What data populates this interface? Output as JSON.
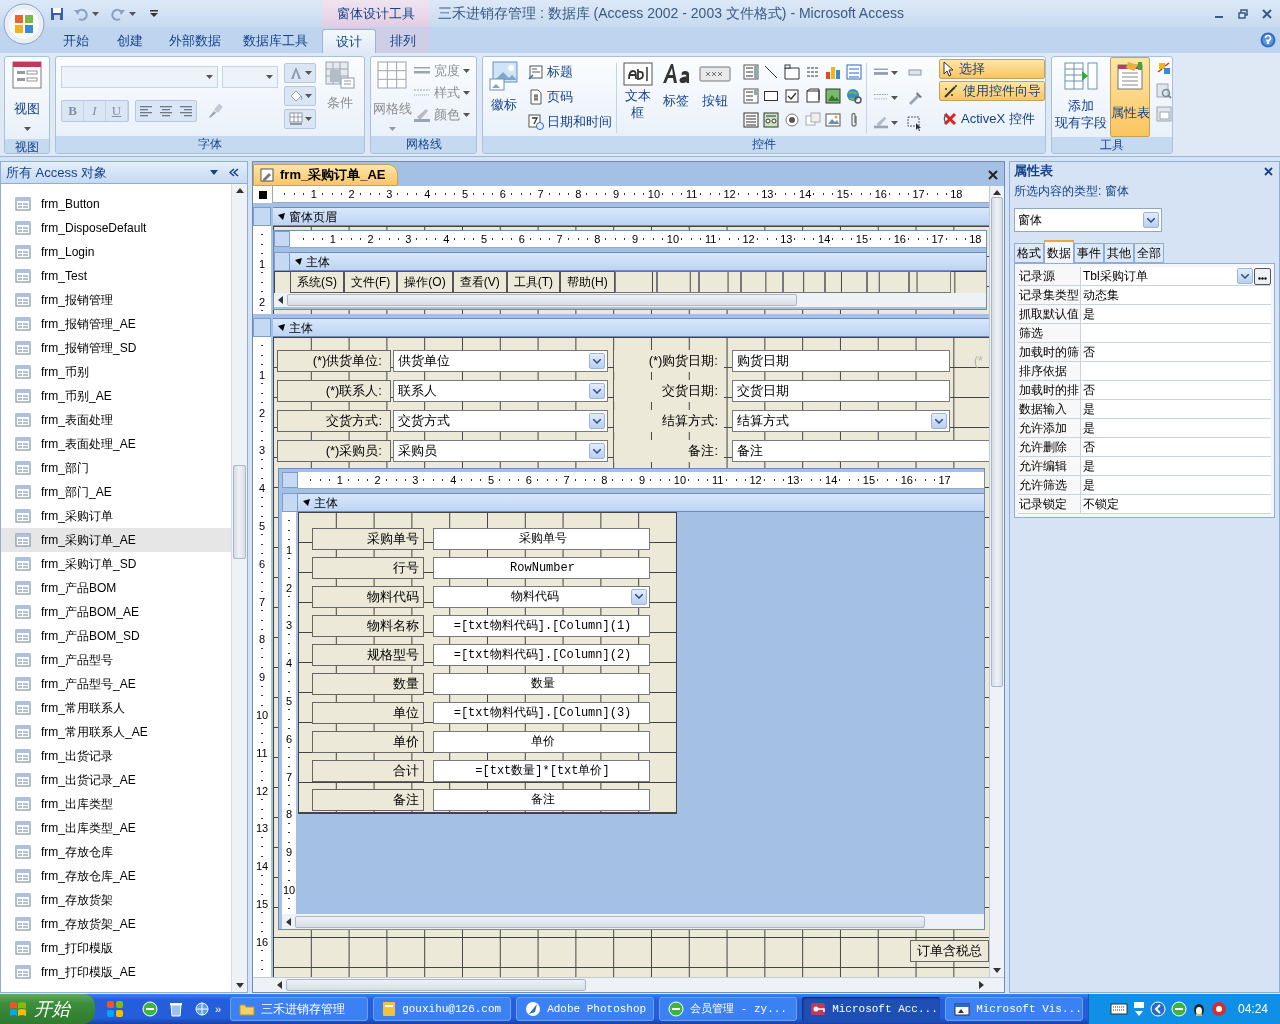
{
  "window": {
    "title": "三禾进销存管理 : 数据库 (Access 2002 - 2003 文件格式) - Microsoft Access",
    "context_tab": "窗体设计工具"
  },
  "ribbon_tabs": [
    {
      "label": "开始",
      "selected": false
    },
    {
      "label": "创建",
      "selected": false
    },
    {
      "label": "外部数据",
      "selected": false
    },
    {
      "label": "数据库工具",
      "selected": false
    },
    {
      "label": "设计",
      "selected": true
    },
    {
      "label": "排列",
      "selected": false
    }
  ],
  "ribbon": {
    "view_group": {
      "caption": "视图",
      "button": "视图"
    },
    "font_group": {
      "caption": "字体",
      "format_buttons": [
        "B",
        "I",
        "U"
      ],
      "condition": "条件",
      "disabled": true
    },
    "gridlines_group": {
      "caption": "网格线",
      "gridlines": "网格线",
      "options": [
        "宽度",
        "样式",
        "颜色"
      ],
      "disabled": true
    },
    "controls_group": {
      "caption": "控件",
      "logo": "徽标",
      "small_buttons": [
        "标题",
        "页码",
        "日期和时间"
      ],
      "text_box": [
        "文本",
        "框"
      ],
      "label": "标签",
      "button": "按钮",
      "select": {
        "label": "选择",
        "on": true
      },
      "wizard": {
        "label": "使用控件向导",
        "on": true
      },
      "activex": "ActiveX 控件"
    },
    "tools_group": {
      "caption": "工具",
      "add_fields": [
        "添加",
        "现有字段"
      ],
      "property_sheet": {
        "label": "属性表",
        "on": true
      }
    }
  },
  "navigation": {
    "header": "所有 Access 对象",
    "items": [
      {
        "label": "frm_Button",
        "selected": false
      },
      {
        "label": "frm_DisposeDefault",
        "selected": false
      },
      {
        "label": "frm_Login",
        "selected": false
      },
      {
        "label": "frm_Test",
        "selected": false
      },
      {
        "label": "frm_报销管理",
        "selected": false
      },
      {
        "label": "frm_报销管理_AE",
        "selected": false
      },
      {
        "label": "frm_报销管理_SD",
        "selected": false
      },
      {
        "label": "frm_币别",
        "selected": false
      },
      {
        "label": "frm_币别_AE",
        "selected": false
      },
      {
        "label": "frm_表面处理",
        "selected": false
      },
      {
        "label": "frm_表面处理_AE",
        "selected": false
      },
      {
        "label": "frm_部门",
        "selected": false
      },
      {
        "label": "frm_部门_AE",
        "selected": false
      },
      {
        "label": "frm_采购订单",
        "selected": false
      },
      {
        "label": "frm_采购订单_AE",
        "selected": true
      },
      {
        "label": "frm_采购订单_SD",
        "selected": false
      },
      {
        "label": "frm_产品BOM",
        "selected": false
      },
      {
        "label": "frm_产品BOM_AE",
        "selected": false
      },
      {
        "label": "frm_产品BOM_SD",
        "selected": false
      },
      {
        "label": "frm_产品型号",
        "selected": false
      },
      {
        "label": "frm_产品型号_AE",
        "selected": false
      },
      {
        "label": "frm_常用联系人",
        "selected": false
      },
      {
        "label": "frm_常用联系人_AE",
        "selected": false
      },
      {
        "label": "frm_出货记录",
        "selected": false
      },
      {
        "label": "frm_出货记录_AE",
        "selected": false
      },
      {
        "label": "frm_出库类型",
        "selected": false
      },
      {
        "label": "frm_出库类型_AE",
        "selected": false
      },
      {
        "label": "frm_存放仓库",
        "selected": false
      },
      {
        "label": "frm_存放仓库_AE",
        "selected": false
      },
      {
        "label": "frm_存放货架",
        "selected": false
      },
      {
        "label": "frm_存放货架_AE",
        "selected": false
      },
      {
        "label": "frm_打印模版",
        "selected": false
      },
      {
        "label": "frm_打印模版_AE",
        "selected": false
      }
    ]
  },
  "designer": {
    "tab": "frm_采购订单_AE",
    "ruler": [
      "1",
      "2",
      "3",
      "4",
      "5",
      "6",
      "7",
      "8",
      "9",
      "10",
      "11",
      "12",
      "13",
      "14",
      "15",
      "16",
      "17",
      "18"
    ],
    "vertical_ruler_header": [
      "1",
      "2"
    ],
    "vertical_ruler_detail": [
      "1",
      "2",
      "3",
      "4",
      "5",
      "6",
      "7",
      "8",
      "9",
      "10",
      "11",
      "12",
      "13",
      "14",
      "15",
      "16"
    ],
    "form_header": {
      "title": "窗体页眉",
      "menu_subform": {
        "ruler": [
          "1",
          "2",
          "3",
          "4",
          "5",
          "6",
          "7",
          "8",
          "9",
          "10",
          "11",
          "12",
          "13",
          "14",
          "15",
          "16",
          "17",
          "18"
        ],
        "section": "主体",
        "menu_buttons": [
          "系统(S)",
          "文件(F)",
          "操作(O)",
          "查看(V)",
          "工具(T)",
          "帮助(H)"
        ]
      }
    },
    "detail": {
      "title": "主体",
      "left_fields": [
        {
          "label": "(*)供货单位:",
          "value": "供货单位",
          "kind": "combo"
        },
        {
          "label": "(*)联系人:",
          "value": "联系人",
          "kind": "combo"
        },
        {
          "label": "交货方式:",
          "value": "交货方式",
          "kind": "combo"
        },
        {
          "label": "(*)采购员:",
          "value": "采购员",
          "kind": "combo"
        }
      ],
      "right_fields": [
        {
          "label": "(*)购货日期:",
          "value": "购货日期",
          "kind": "text"
        },
        {
          "label": "交货日期:",
          "value": "交货日期",
          "kind": "text"
        },
        {
          "label": "结算方式:",
          "value": "结算方式",
          "kind": "combo"
        },
        {
          "label": "备注:",
          "value": "备注",
          "kind": "wide"
        }
      ],
      "edge_label": "(*",
      "lines_subform": {
        "ruler": [
          "1",
          "2",
          "3",
          "4",
          "5",
          "6",
          "7",
          "8",
          "9",
          "10",
          "11",
          "12",
          "13",
          "14",
          "15",
          "16",
          "17"
        ],
        "vertical_ruler": [
          "1",
          "2",
          "3",
          "4",
          "5",
          "6",
          "7",
          "8",
          "9",
          "10"
        ],
        "section": "主体",
        "fields": [
          {
            "label": "采购单号",
            "value": "采购单号",
            "kind": "text"
          },
          {
            "label": "行号",
            "value": "RowNumber",
            "kind": "text"
          },
          {
            "label": "物料代码",
            "value": "物料代码",
            "kind": "combo"
          },
          {
            "label": "物料名称",
            "value": "=[txt物料代码].[Column](1)",
            "kind": "text"
          },
          {
            "label": "规格型号",
            "value": "=[txt物料代码].[Column](2)",
            "kind": "text"
          },
          {
            "label": "数量",
            "value": "数量",
            "kind": "text"
          },
          {
            "label": "单位",
            "value": "=[txt物料代码].[Column](3)",
            "kind": "text"
          },
          {
            "label": "单价",
            "value": "单价",
            "kind": "text"
          },
          {
            "label": "合计",
            "value": "=[txt数量]*[txt单价]",
            "kind": "text"
          },
          {
            "label": "备注",
            "value": "备注",
            "kind": "text"
          }
        ]
      },
      "total_label": "订单含税总"
    }
  },
  "property_sheet": {
    "title": "属性表",
    "selection_type": "所选内容的类型: 窗体",
    "object": "窗体",
    "tabs": [
      {
        "label": "格式",
        "selected": false
      },
      {
        "label": "数据",
        "selected": true
      },
      {
        "label": "事件",
        "selected": false
      },
      {
        "label": "其他",
        "selected": false
      },
      {
        "label": "全部",
        "selected": false
      }
    ],
    "rows": [
      {
        "name": "记录源",
        "value": "Tbl采购订单",
        "kind": "builder"
      },
      {
        "name": "记录集类型",
        "value": "动态集",
        "kind": "plain"
      },
      {
        "name": "抓取默认值",
        "value": "是",
        "kind": "plain"
      },
      {
        "name": "筛选",
        "kind": "plain"
      },
      {
        "name": "加载时的筛",
        "value": "否",
        "kind": "plain"
      },
      {
        "name": "排序依据",
        "kind": "plain"
      },
      {
        "name": "加载时的排",
        "value": "否",
        "kind": "plain"
      },
      {
        "name": "数据输入",
        "value": "是",
        "kind": "plain"
      },
      {
        "name": "允许添加",
        "value": "是",
        "kind": "plain"
      },
      {
        "name": "允许删除",
        "value": "否",
        "kind": "plain"
      },
      {
        "name": "允许编辑",
        "value": "是",
        "kind": "plain"
      },
      {
        "name": "允许筛选",
        "value": "是",
        "kind": "plain"
      },
      {
        "name": "记录锁定",
        "value": "不锁定",
        "kind": "plain"
      }
    ]
  },
  "taskbar": {
    "start": "开始",
    "more": "»",
    "buttons": [
      {
        "label": "三禾进销存管理",
        "selected": false
      },
      {
        "label": "gouxihu@126.com",
        "selected": false
      },
      {
        "label": "Adobe Photoshop",
        "selected": false
      },
      {
        "label": "会员管理 - zy...",
        "selected": false
      },
      {
        "label": "Microsoft Acc...",
        "selected": true
      },
      {
        "label": "Microsoft Vis...",
        "selected": false
      }
    ],
    "clock": "04:24"
  }
}
